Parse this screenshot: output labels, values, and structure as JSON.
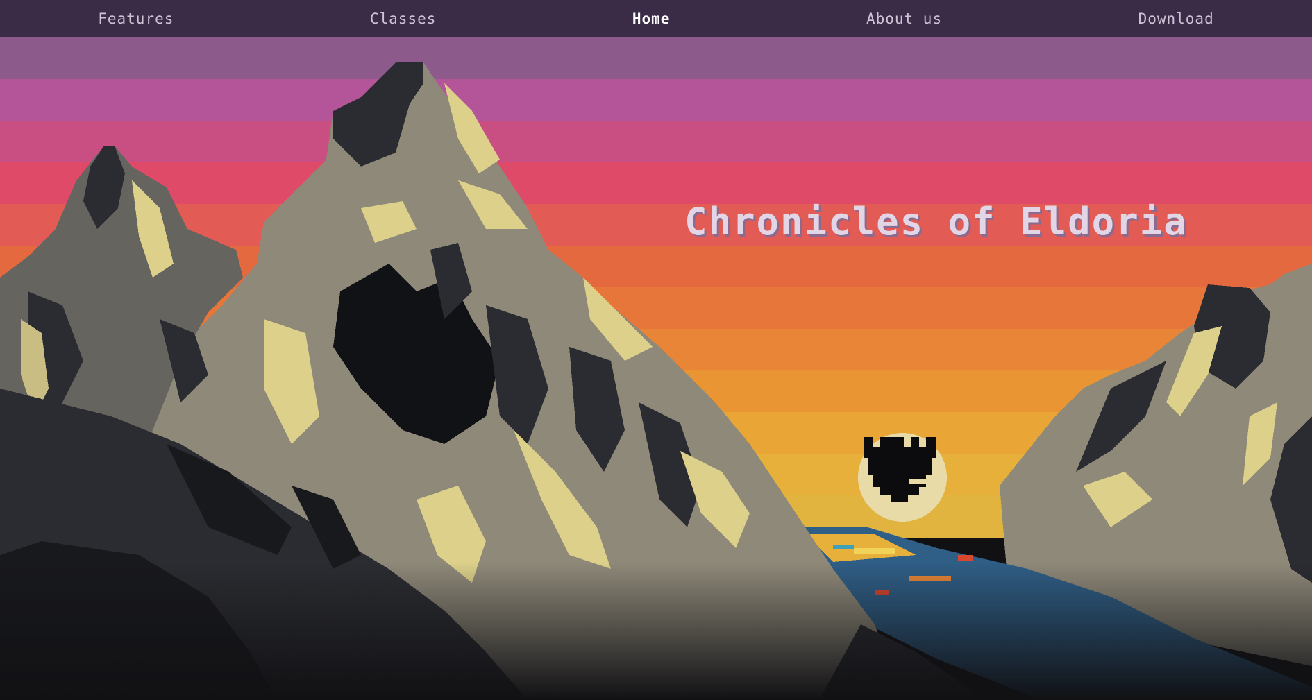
{
  "nav": {
    "items": [
      {
        "id": "features",
        "label": "Features"
      },
      {
        "id": "classes",
        "label": "Classes"
      },
      {
        "id": "home",
        "label": "Home"
      },
      {
        "id": "about",
        "label": "About us"
      },
      {
        "id": "download",
        "label": "Download"
      }
    ],
    "active": "home"
  },
  "hero": {
    "title": "Chronicles of Eldoria",
    "sky_bands": [
      "#8d5a8c",
      "#b4559a",
      "#c94f83",
      "#df4a68",
      "#e25b55",
      "#e5693f",
      "#e7763a",
      "#e88536",
      "#e99534",
      "#e9a535",
      "#e6b03a",
      "#e1b33f"
    ],
    "colors": {
      "navbar": "#3a2c47",
      "rock_dark": "#2b2c31",
      "rock_mid": "#8f8979",
      "rock_light": "#ddd08a",
      "moon": "#e8dba8",
      "water": "#2f5e86"
    }
  }
}
